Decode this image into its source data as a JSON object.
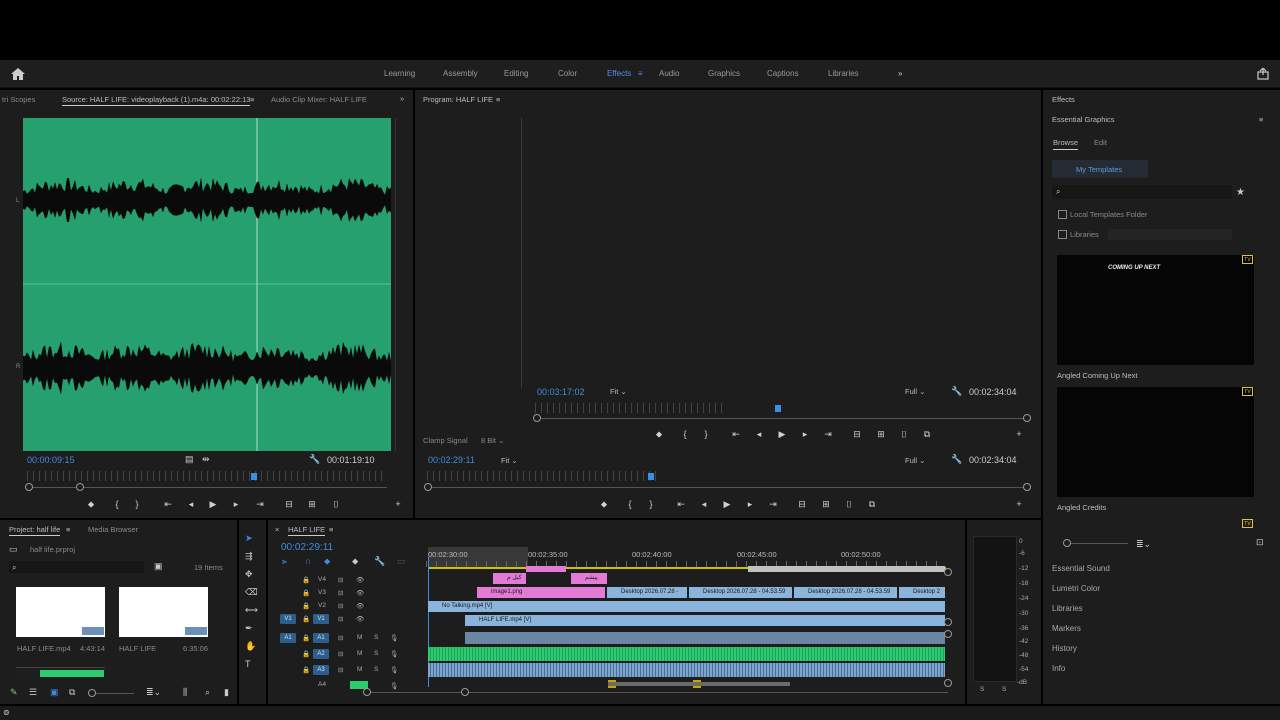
{
  "workspaces": [
    "Learning",
    "Assembly",
    "Editing",
    "Color",
    "Effects",
    "Audio",
    "Graphics",
    "Captions",
    "Libraries"
  ],
  "active_workspace": "Effects",
  "source_panel": {
    "tabs": [
      "tri Scopes",
      "Source: HALF LIFE: videoplayback (1).m4a: 00:02:22:13",
      "Audio Clip Mixer: HALF LIFE"
    ],
    "timecode_in": "00:00:09:15",
    "timecode_out": "00:01:19:10",
    "label_l": "L",
    "label_r": "R"
  },
  "program_panel": {
    "title": "Program: HALF LIFE",
    "inner_timecode": "00:03:17:02",
    "inner_fit": "Fit",
    "inner_full": "Full",
    "inner_duration": "00:02:34:04",
    "clamp_signal": "Clamp Signal",
    "bit_depth": "8 Bit",
    "timecode": "00:02:29:11",
    "fit": "Fit",
    "full": "Full",
    "duration": "00:02:34:04"
  },
  "project_panel": {
    "tabs": [
      "Project: half life",
      "Media Browser"
    ],
    "file": "half life.prproj",
    "count": "19 Items",
    "items": [
      {
        "name": "HALF LIFE.mp4",
        "duration": "4:43:14"
      },
      {
        "name": "HALF LIFE",
        "duration": "6:35:06"
      }
    ]
  },
  "timeline": {
    "tab": "HALF LIFE",
    "timecode": "00:02:29:11",
    "ruler": [
      "00:02:30:00",
      "00:02:35:00",
      "00:02:40:00",
      "00:02:45:00",
      "00:02:50:00"
    ],
    "video_tracks": [
      "V4",
      "V3",
      "V2",
      "V1"
    ],
    "audio_tracks": [
      "A1",
      "A2",
      "A3",
      "A4"
    ],
    "src_v": "V1",
    "src_a": "A1",
    "clips": {
      "image1": "image1.png",
      "no_talking": "No Talking.mp4 [V]",
      "half_life": "HALF LIFE.mp4 [V]",
      "desktop1": "Desktop 2026.07.28 -",
      "desktop2": "Desktop 2026.07.28 - 04.53.59",
      "desktop3": "Desktop 2026.07.28 - 04.53.59",
      "desktop4": "Desktop 2",
      "pink1": "کیل م",
      "pink2": "پیشم"
    },
    "meter_labels": [
      "0",
      "-6",
      "-12",
      "-18",
      "-24",
      "-30",
      "-36",
      "-42",
      "-48",
      "-54",
      "-dB"
    ],
    "solo": "S",
    "mute": "M"
  },
  "effects_panel": {
    "title": "Effects",
    "eg_title": "Essential Graphics",
    "tabs": [
      "Browse",
      "Edit"
    ],
    "my_templates": "My Templates",
    "checkboxes": [
      "Local Templates Folder",
      "Libraries"
    ],
    "templates": [
      {
        "name": "Angled Coming Up Next",
        "preview_text": "COMING UP NEXT"
      },
      {
        "name": "Angled Credits",
        "preview_text": ""
      }
    ],
    "sections": [
      "Essential Sound",
      "Lumetri Color",
      "Libraries",
      "Markers",
      "History",
      "Info"
    ]
  },
  "colors": {
    "accent": "#3d8de0",
    "waveform_bg": "#27a06f",
    "audio_clip": "#2ecc71",
    "video_clip": "#8ab4dc",
    "pink_clip": "#e27ad6"
  }
}
